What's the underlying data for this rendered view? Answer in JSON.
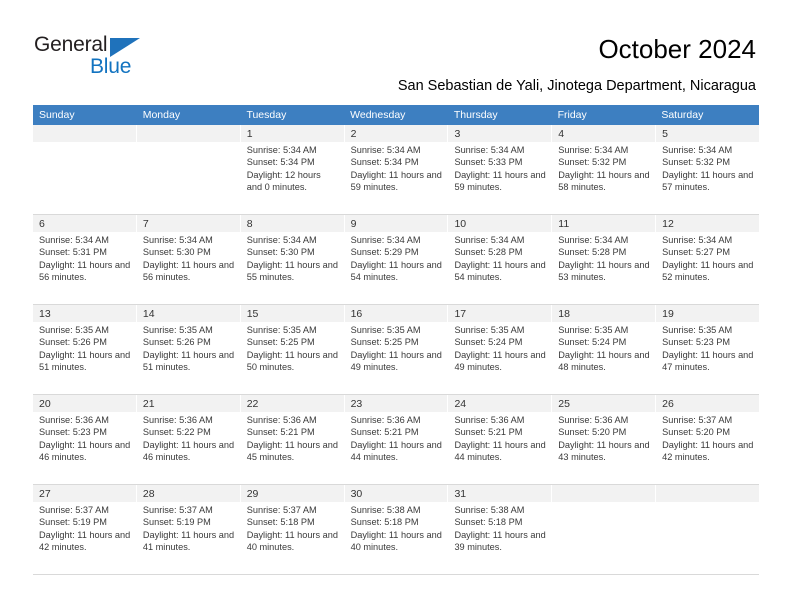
{
  "brand": {
    "name_top": "General",
    "name_bottom": "Blue",
    "accent_color": "#1273c0",
    "triangle_color": "#1f72bb"
  },
  "header": {
    "title": "October 2024",
    "subtitle": "San Sebastian de Yali, Jinotega Department, Nicaragua"
  },
  "calendar": {
    "header_bg": "#3d7fc1",
    "weekdays": [
      "Sunday",
      "Monday",
      "Tuesday",
      "Wednesday",
      "Thursday",
      "Friday",
      "Saturday"
    ],
    "weeks": [
      [
        {
          "day": "",
          "sunrise": "",
          "sunset": "",
          "daylight": "",
          "empty": true
        },
        {
          "day": "",
          "sunrise": "",
          "sunset": "",
          "daylight": "",
          "empty": true
        },
        {
          "day": "1",
          "sunrise": "Sunrise: 5:34 AM",
          "sunset": "Sunset: 5:34 PM",
          "daylight": "Daylight: 12 hours and 0 minutes."
        },
        {
          "day": "2",
          "sunrise": "Sunrise: 5:34 AM",
          "sunset": "Sunset: 5:34 PM",
          "daylight": "Daylight: 11 hours and 59 minutes."
        },
        {
          "day": "3",
          "sunrise": "Sunrise: 5:34 AM",
          "sunset": "Sunset: 5:33 PM",
          "daylight": "Daylight: 11 hours and 59 minutes."
        },
        {
          "day": "4",
          "sunrise": "Sunrise: 5:34 AM",
          "sunset": "Sunset: 5:32 PM",
          "daylight": "Daylight: 11 hours and 58 minutes."
        },
        {
          "day": "5",
          "sunrise": "Sunrise: 5:34 AM",
          "sunset": "Sunset: 5:32 PM",
          "daylight": "Daylight: 11 hours and 57 minutes."
        }
      ],
      [
        {
          "day": "6",
          "sunrise": "Sunrise: 5:34 AM",
          "sunset": "Sunset: 5:31 PM",
          "daylight": "Daylight: 11 hours and 56 minutes."
        },
        {
          "day": "7",
          "sunrise": "Sunrise: 5:34 AM",
          "sunset": "Sunset: 5:30 PM",
          "daylight": "Daylight: 11 hours and 56 minutes."
        },
        {
          "day": "8",
          "sunrise": "Sunrise: 5:34 AM",
          "sunset": "Sunset: 5:30 PM",
          "daylight": "Daylight: 11 hours and 55 minutes."
        },
        {
          "day": "9",
          "sunrise": "Sunrise: 5:34 AM",
          "sunset": "Sunset: 5:29 PM",
          "daylight": "Daylight: 11 hours and 54 minutes."
        },
        {
          "day": "10",
          "sunrise": "Sunrise: 5:34 AM",
          "sunset": "Sunset: 5:28 PM",
          "daylight": "Daylight: 11 hours and 54 minutes."
        },
        {
          "day": "11",
          "sunrise": "Sunrise: 5:34 AM",
          "sunset": "Sunset: 5:28 PM",
          "daylight": "Daylight: 11 hours and 53 minutes."
        },
        {
          "day": "12",
          "sunrise": "Sunrise: 5:34 AM",
          "sunset": "Sunset: 5:27 PM",
          "daylight": "Daylight: 11 hours and 52 minutes."
        }
      ],
      [
        {
          "day": "13",
          "sunrise": "Sunrise: 5:35 AM",
          "sunset": "Sunset: 5:26 PM",
          "daylight": "Daylight: 11 hours and 51 minutes."
        },
        {
          "day": "14",
          "sunrise": "Sunrise: 5:35 AM",
          "sunset": "Sunset: 5:26 PM",
          "daylight": "Daylight: 11 hours and 51 minutes."
        },
        {
          "day": "15",
          "sunrise": "Sunrise: 5:35 AM",
          "sunset": "Sunset: 5:25 PM",
          "daylight": "Daylight: 11 hours and 50 minutes."
        },
        {
          "day": "16",
          "sunrise": "Sunrise: 5:35 AM",
          "sunset": "Sunset: 5:25 PM",
          "daylight": "Daylight: 11 hours and 49 minutes."
        },
        {
          "day": "17",
          "sunrise": "Sunrise: 5:35 AM",
          "sunset": "Sunset: 5:24 PM",
          "daylight": "Daylight: 11 hours and 49 minutes."
        },
        {
          "day": "18",
          "sunrise": "Sunrise: 5:35 AM",
          "sunset": "Sunset: 5:24 PM",
          "daylight": "Daylight: 11 hours and 48 minutes."
        },
        {
          "day": "19",
          "sunrise": "Sunrise: 5:35 AM",
          "sunset": "Sunset: 5:23 PM",
          "daylight": "Daylight: 11 hours and 47 minutes."
        }
      ],
      [
        {
          "day": "20",
          "sunrise": "Sunrise: 5:36 AM",
          "sunset": "Sunset: 5:23 PM",
          "daylight": "Daylight: 11 hours and 46 minutes."
        },
        {
          "day": "21",
          "sunrise": "Sunrise: 5:36 AM",
          "sunset": "Sunset: 5:22 PM",
          "daylight": "Daylight: 11 hours and 46 minutes."
        },
        {
          "day": "22",
          "sunrise": "Sunrise: 5:36 AM",
          "sunset": "Sunset: 5:21 PM",
          "daylight": "Daylight: 11 hours and 45 minutes."
        },
        {
          "day": "23",
          "sunrise": "Sunrise: 5:36 AM",
          "sunset": "Sunset: 5:21 PM",
          "daylight": "Daylight: 11 hours and 44 minutes."
        },
        {
          "day": "24",
          "sunrise": "Sunrise: 5:36 AM",
          "sunset": "Sunset: 5:21 PM",
          "daylight": "Daylight: 11 hours and 44 minutes."
        },
        {
          "day": "25",
          "sunrise": "Sunrise: 5:36 AM",
          "sunset": "Sunset: 5:20 PM",
          "daylight": "Daylight: 11 hours and 43 minutes."
        },
        {
          "day": "26",
          "sunrise": "Sunrise: 5:37 AM",
          "sunset": "Sunset: 5:20 PM",
          "daylight": "Daylight: 11 hours and 42 minutes."
        }
      ],
      [
        {
          "day": "27",
          "sunrise": "Sunrise: 5:37 AM",
          "sunset": "Sunset: 5:19 PM",
          "daylight": "Daylight: 11 hours and 42 minutes."
        },
        {
          "day": "28",
          "sunrise": "Sunrise: 5:37 AM",
          "sunset": "Sunset: 5:19 PM",
          "daylight": "Daylight: 11 hours and 41 minutes."
        },
        {
          "day": "29",
          "sunrise": "Sunrise: 5:37 AM",
          "sunset": "Sunset: 5:18 PM",
          "daylight": "Daylight: 11 hours and 40 minutes."
        },
        {
          "day": "30",
          "sunrise": "Sunrise: 5:38 AM",
          "sunset": "Sunset: 5:18 PM",
          "daylight": "Daylight: 11 hours and 40 minutes."
        },
        {
          "day": "31",
          "sunrise": "Sunrise: 5:38 AM",
          "sunset": "Sunset: 5:18 PM",
          "daylight": "Daylight: 11 hours and 39 minutes."
        },
        {
          "day": "",
          "sunrise": "",
          "sunset": "",
          "daylight": "",
          "empty": true
        },
        {
          "day": "",
          "sunrise": "",
          "sunset": "",
          "daylight": "",
          "empty": true
        }
      ]
    ]
  }
}
